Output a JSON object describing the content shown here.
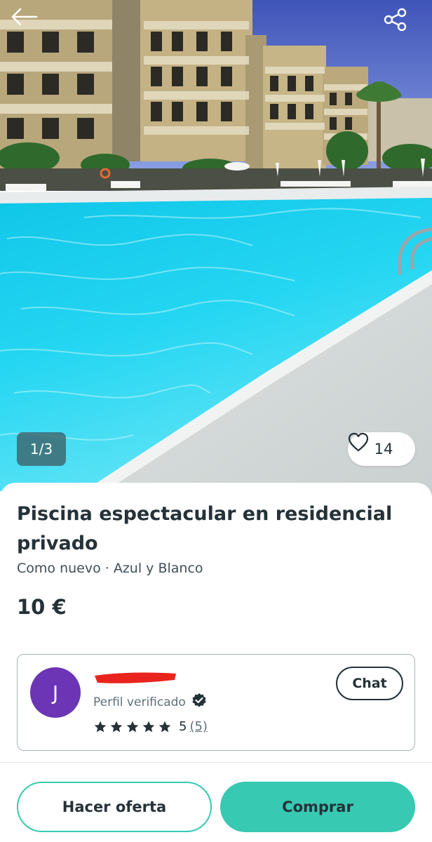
{
  "gallery": {
    "counter": "1/3",
    "likes": "14",
    "image": "pool-photo"
  },
  "listing": {
    "title": "Piscina espectacular en residencial privado",
    "subtitle": "Como nuevo · Azul y Blanco",
    "price": "10 €"
  },
  "seller": {
    "avatar_initial": "J",
    "verified_label": "Perfil verificado",
    "rating_stars": 5,
    "rating_score": "5",
    "rating_count": "(5)",
    "chat_label": "Chat"
  },
  "actions": {
    "offer_label": "Hacer oferta",
    "buy_label": "Comprar"
  },
  "icons": {
    "back": "arrow-left-icon",
    "share": "share-icon",
    "favorite": "heart-icon",
    "verified": "verified-badge-icon",
    "star": "star-icon"
  },
  "colors": {
    "accent": "#38c9b3",
    "avatar": "#6b35b5",
    "text": "#253238",
    "redaction": "#e8241c"
  }
}
